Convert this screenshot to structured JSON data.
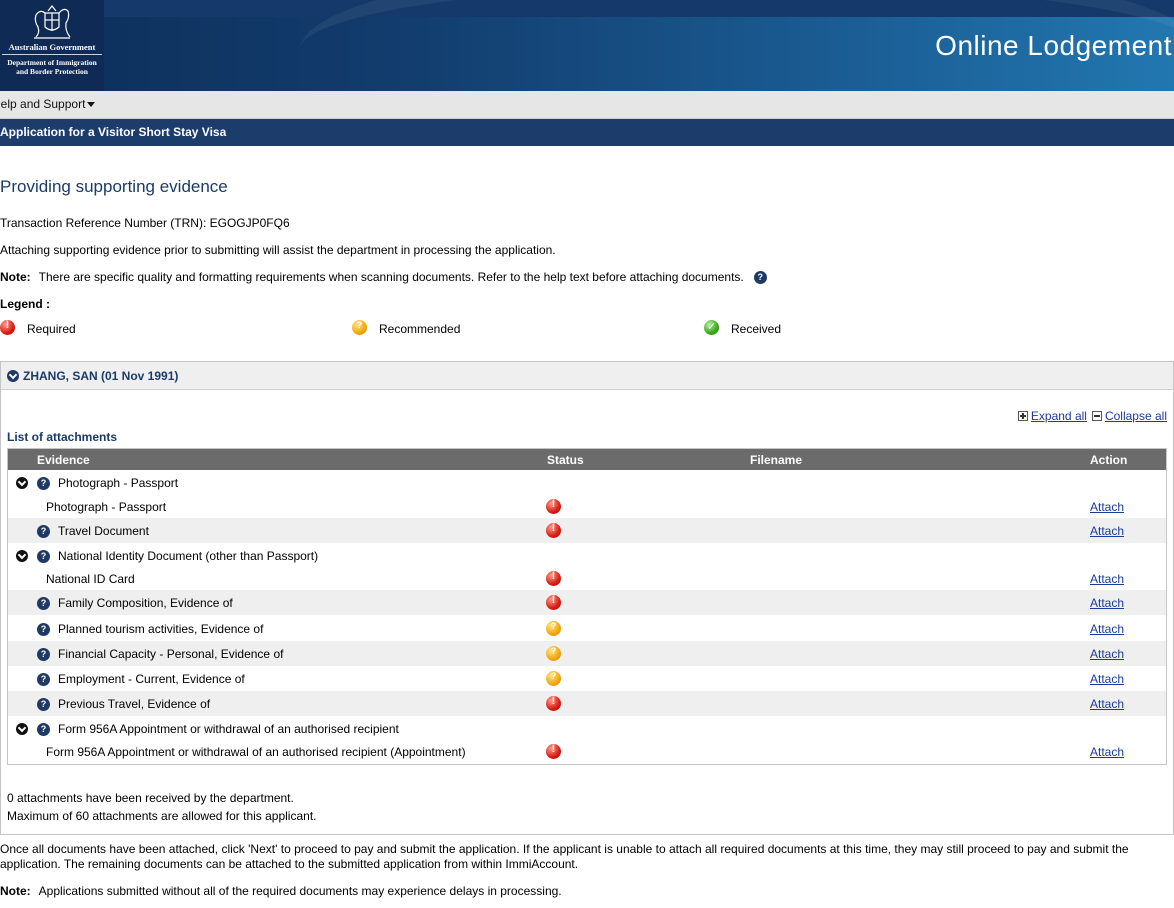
{
  "header": {
    "gov_line1": "Australian Government",
    "gov_line2": "Department of Immigration",
    "gov_line3": "and Border Protection",
    "app_title": "Online Lodgement"
  },
  "menu": {
    "help": "Help and Support"
  },
  "appbar": {
    "title": "Application for a Visitor Short Stay Visa"
  },
  "page": {
    "title": "Providing supporting evidence",
    "trn": "Transaction Reference Number (TRN): EGOGJP0FQ6",
    "intro": "Attaching supporting evidence prior to submitting will assist the department in processing the application.",
    "note_label": "Note:",
    "note_text": "There are specific quality and formatting requirements when scanning documents. Refer to the help text before attaching documents.",
    "legend_label": "Legend :",
    "legend": {
      "required": "Required",
      "recommended": "Recommended",
      "received": "Received"
    }
  },
  "applicant": {
    "name": "ZHANG, SAN (01 Nov 1991)",
    "expand_all": "Expand all",
    "collapse_all": "Collapse all",
    "list_label": "List of attachments",
    "columns": {
      "evidence": "Evidence",
      "status": "Status",
      "filename": "Filename",
      "action": "Action"
    },
    "rows": [
      {
        "evidence": "Photograph - Passport",
        "kind": "group"
      },
      {
        "evidence": "Photograph - Passport",
        "kind": "child",
        "status": "required",
        "action": "Attach"
      },
      {
        "evidence": "Travel Document",
        "kind": "item",
        "status": "required",
        "action": "Attach"
      },
      {
        "evidence": "National Identity Document (other than Passport)",
        "kind": "group"
      },
      {
        "evidence": "National ID Card",
        "kind": "child",
        "status": "required",
        "action": "Attach"
      },
      {
        "evidence": "Family Composition, Evidence of",
        "kind": "item",
        "status": "required",
        "action": "Attach"
      },
      {
        "evidence": "Planned tourism activities, Evidence of",
        "kind": "item",
        "status": "recommended",
        "action": "Attach"
      },
      {
        "evidence": "Financial Capacity - Personal, Evidence of",
        "kind": "item",
        "status": "recommended",
        "action": "Attach"
      },
      {
        "evidence": "Employment - Current, Evidence of",
        "kind": "item",
        "status": "recommended",
        "action": "Attach"
      },
      {
        "evidence": "Previous Travel, Evidence of",
        "kind": "item",
        "status": "required",
        "action": "Attach"
      },
      {
        "evidence": "Form 956A Appointment or withdrawal of an authorised recipient",
        "kind": "group"
      },
      {
        "evidence": "Form 956A Appointment or withdrawal of an authorised recipient (Appointment)",
        "kind": "child",
        "status": "required",
        "action": "Attach"
      }
    ],
    "received_summary": "0 attachments have been received by the department.",
    "max_summary": "Maximum of 60 attachments are allowed for this applicant."
  },
  "footer": {
    "instructions": "Once all documents have been attached, click 'Next' to proceed to pay and submit the application. If the applicant is unable to attach all required documents at this time, they may still proceed to pay and submit the application. The remaining documents can be attached to the submitted application from within ImmiAccount.",
    "note_label": "Note:",
    "note_text": "Applications submitted without all of the required documents may experience delays in processing."
  },
  "colors": {
    "navy": "#1c3c6b",
    "required": "#d71c12",
    "recommended": "#f2a70c",
    "received": "#3aa61c"
  }
}
